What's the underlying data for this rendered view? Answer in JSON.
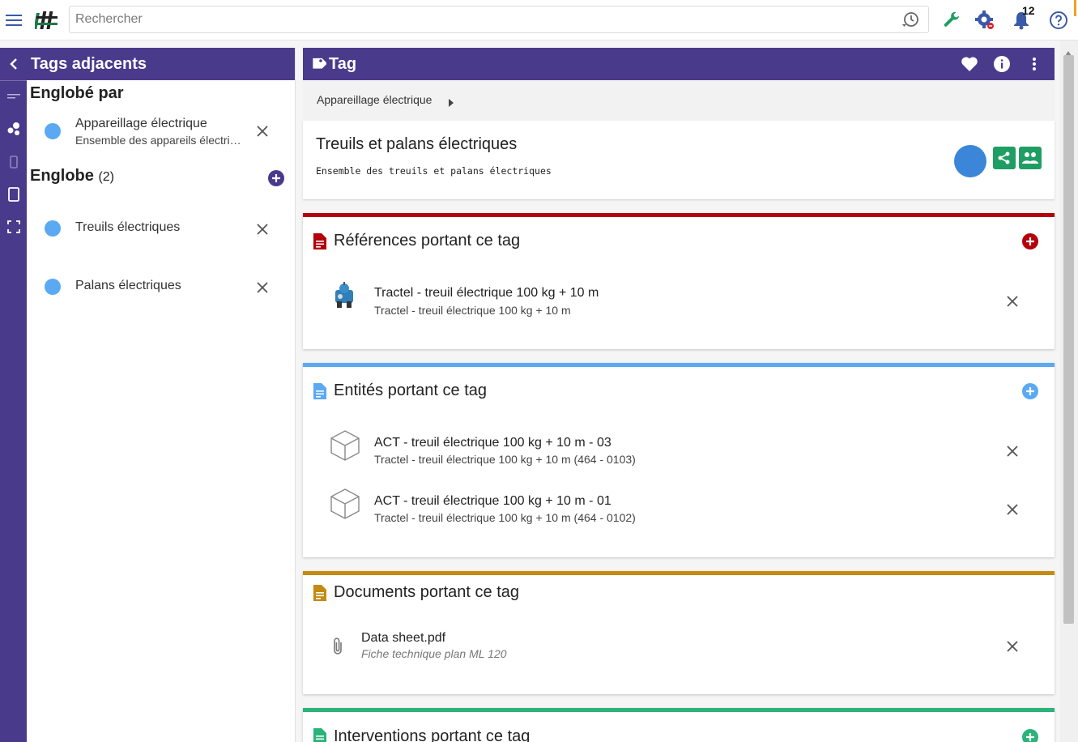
{
  "search": {
    "placeholder": "Rechercher"
  },
  "topbar": {
    "notification_count": "12"
  },
  "adjacent": {
    "title": "Tags adjacents",
    "parent_section": "Englobé par",
    "parent_item": {
      "label": "Appareillage électrique",
      "description": "Ensemble des appareils électriques"
    },
    "children_section": "Englobe",
    "children_count": "(2)",
    "children": [
      {
        "label": "Treuils électriques"
      },
      {
        "label": "Palans électriques"
      }
    ]
  },
  "tag": {
    "header_title": "Tag",
    "breadcrumb": "Appareillage électrique",
    "name": "Treuils et palans électriques",
    "description": "Ensemble des treuils et palans électriques"
  },
  "references": {
    "title": "Références portant ce tag",
    "color": "#b3000b",
    "items": [
      {
        "title": "Tractel - treuil électrique 100 kg + 10 m",
        "subtitle": "Tractel - treuil électrique 100 kg + 10 m"
      }
    ]
  },
  "entities": {
    "title": "Entités portant ce tag",
    "color": "#5aa9f2",
    "items": [
      {
        "title": "ACT - treuil électrique 100 kg + 10 m - 03",
        "subtitle": "Tractel - treuil électrique 100 kg + 10 m (464 - 0103)"
      },
      {
        "title": "ACT - treuil électrique 100 kg + 10 m - 01",
        "subtitle": "Tractel - treuil électrique 100 kg + 10 m (464 - 0102)"
      }
    ]
  },
  "documents": {
    "title": "Documents portant ce tag",
    "color": "#c58a10",
    "items": [
      {
        "title": "Data sheet.pdf",
        "subtitle": "Fiche technique plan ML 120"
      }
    ]
  },
  "interventions": {
    "title": "Interventions portant ce tag",
    "color": "#2bb37a"
  },
  "theme": {
    "primary": "#4a3a8c",
    "green": "#1f9e63"
  }
}
